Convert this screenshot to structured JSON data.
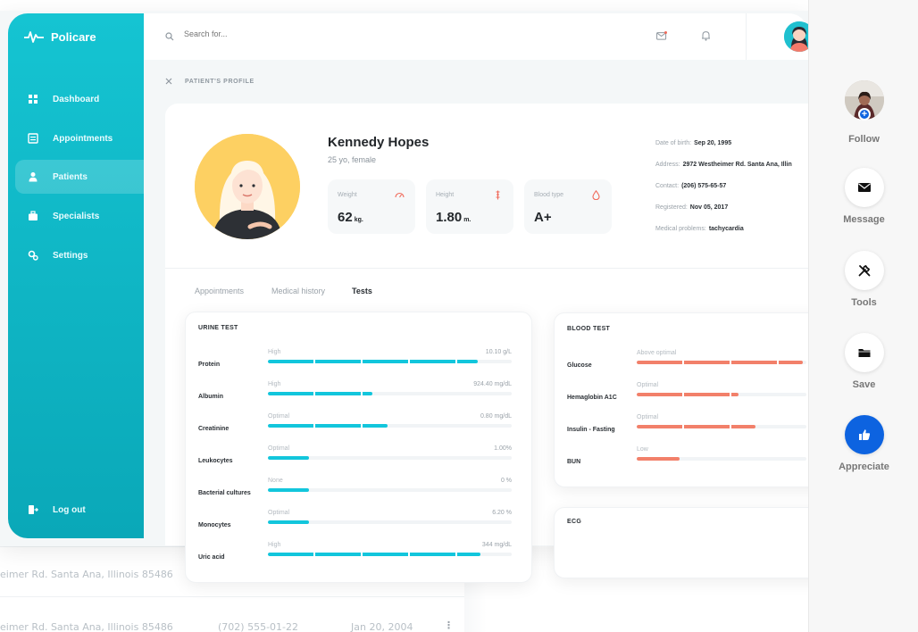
{
  "brand": {
    "name": "Policare"
  },
  "sidebar": {
    "items": [
      {
        "label": "Dashboard",
        "icon": "grid-icon"
      },
      {
        "label": "Appointments",
        "icon": "calendar-icon"
      },
      {
        "label": "Patients",
        "icon": "person-icon",
        "active": true
      },
      {
        "label": "Specialists",
        "icon": "briefcase-icon"
      },
      {
        "label": "Settings",
        "icon": "gear-icon"
      }
    ],
    "logout": "Log out"
  },
  "topbar": {
    "search_placeholder": "Search for..."
  },
  "breadcrumb": "PATIENT'S PROFILE",
  "patient": {
    "name": "Kennedy Hopes",
    "subtitle": "25 yo, female",
    "stats": [
      {
        "label": "Weight",
        "value": "62",
        "unit": "kg."
      },
      {
        "label": "Height",
        "value": "1.80",
        "unit": "m."
      },
      {
        "label": "Blood type",
        "value": "A+",
        "unit": ""
      }
    ],
    "info": [
      {
        "label": "Date of birth:",
        "value": "Sep 20, 1995"
      },
      {
        "label": "Address:",
        "value": "2972 Westheimer Rd. Santa Ana, Illin"
      },
      {
        "label": "Contact:",
        "value": "(206) 575-65-57"
      },
      {
        "label": "Registered:",
        "value": "Nov 05, 2017"
      },
      {
        "label": "Medical problems:",
        "value": "tachycardia"
      }
    ]
  },
  "tabs": [
    "Appointments",
    "Medical history",
    "Tests"
  ],
  "urine_test": {
    "title": "URINE TEST",
    "rows": [
      {
        "name": "Protein",
        "status": "High",
        "value": "10.10 g/L",
        "level": 0.86
      },
      {
        "name": "Albumin",
        "status": "High",
        "value": "924.40 mg/dL",
        "level": 0.43
      },
      {
        "name": "Creatinine",
        "status": "Optimal",
        "value": "0.80 mg/dL",
        "level": 0.49
      },
      {
        "name": "Leukocytes",
        "status": "Optimal",
        "value": "1.00%",
        "level": 0.17
      },
      {
        "name": "Bacterial cultures",
        "status": "None",
        "value": "0 %",
        "level": 0.17
      },
      {
        "name": "Monocytes",
        "status": "Optimal",
        "value": "6.20 %",
        "level": 0.17
      },
      {
        "name": "Uric acid",
        "status": "High",
        "value": "344 mg/dL",
        "level": 0.87
      }
    ]
  },
  "blood_test": {
    "title": "BLOOD TEST",
    "rows": [
      {
        "name": "Glucose",
        "status": "Above optimal",
        "value": "",
        "level": 0.98
      },
      {
        "name": "Hemaglobin A1C",
        "status": "Optimal",
        "value": "",
        "level": 0.6
      },
      {
        "name": "Insulin - Fasting",
        "status": "Optimal",
        "value": "",
        "level": 0.7
      },
      {
        "name": "BUN",
        "status": "Low",
        "value": "",
        "level": 0.25
      }
    ]
  },
  "ecg": {
    "title": "ECG"
  },
  "background_rows": [
    {
      "address": "eimer Rd. Santa Ana, Illinois 85486"
    },
    {
      "address": "eimer Rd. Santa Ana, Illinois 85486",
      "phone": "(702) 555-01-22",
      "date": "Jan 20, 2004"
    }
  ],
  "actions": [
    {
      "label": "Follow"
    },
    {
      "label": "Message"
    },
    {
      "label": "Tools"
    },
    {
      "label": "Save"
    },
    {
      "label": "Appreciate"
    }
  ],
  "colors": {
    "accent": "#12bccb",
    "urine_bar": "#12c6dc",
    "blood_bar": "#f2806a",
    "appreciate": "#0d63e0"
  }
}
